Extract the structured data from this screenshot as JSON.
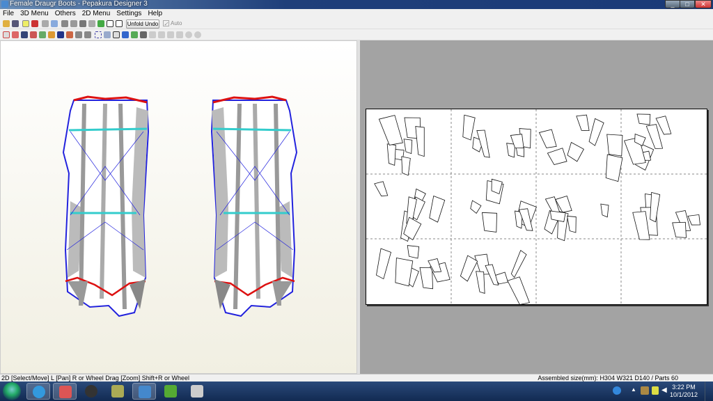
{
  "window": {
    "title": "Female Draugr Boots - Pepakura Designer 3",
    "controls": [
      "minimize",
      "maximize",
      "close"
    ]
  },
  "menu": [
    "File",
    "3D Menu",
    "Others",
    "2D Menu",
    "Settings",
    "Help"
  ],
  "toolbar": {
    "unfold_undo": "Unfold Undo",
    "auto_label": "Auto",
    "auto_checked": true
  },
  "status": {
    "left": "2D [Select/Move] L [Pan] R or Wheel Drag [Zoom] Shift+R or Wheel",
    "right": "Assembled size(mm): H304 W321 D140 / Parts 60"
  },
  "taskbar": {
    "apps": [
      "windows-explorer-ie",
      "internet-explorer",
      "autodesk",
      "hp",
      "file-transfer",
      "pepakura",
      "lime",
      "media"
    ],
    "time": "3:22 PM",
    "date": "10/1/2012"
  },
  "colors": {
    "edge_blue": "#2233dd",
    "cut_red": "#dd1111",
    "fold_cyan": "#33dddd",
    "face_gray": "#b8b8b8"
  }
}
